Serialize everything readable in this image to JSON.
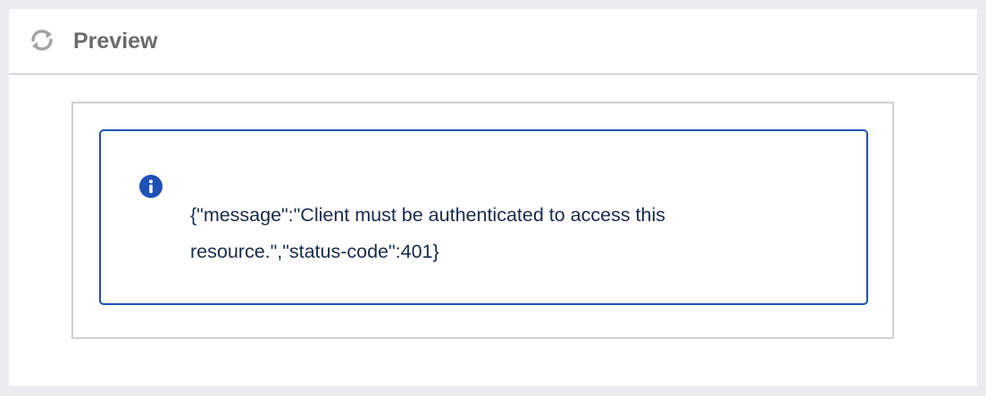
{
  "panel": {
    "title": "Preview",
    "refresh_icon": "refresh-icon"
  },
  "message_box": {
    "icon": "info-icon",
    "text": "{\"message\":\"Client must be authenticated to access this resource.\",\"status-code\":401}",
    "accent_color": "#1f50b5"
  }
}
